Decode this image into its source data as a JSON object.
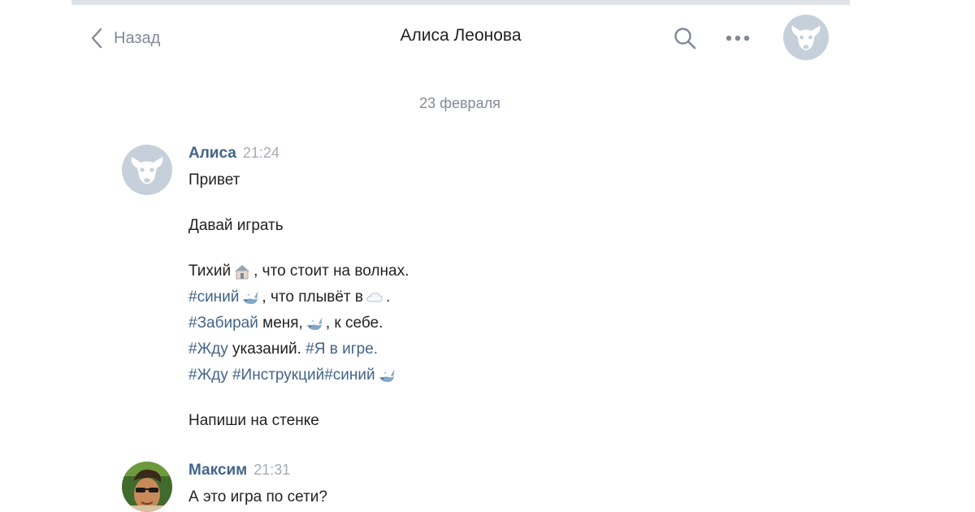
{
  "header": {
    "back_label": "Назад",
    "title": "Алиса Леонова"
  },
  "date_separator": "23 февраля",
  "colors": {
    "author": "#42648b",
    "muted": "#828a99",
    "timestamp": "#a4acb7",
    "avatar_placeholder": "#c5d0db"
  },
  "messages": [
    {
      "author": "Алиса",
      "time": "21:24",
      "lines": {
        "greeting": "Привет",
        "lets_play": "Давай играть",
        "poem_1a": "Тихий",
        "poem_1b": ", что стоит на волнах.",
        "poem_2a": "#синий",
        "poem_2b": ", что плывёт в",
        "poem_2c": ".",
        "poem_3a": "#Забирай",
        "poem_3b": "меня,",
        "poem_3c": ", к себе.",
        "poem_4a": "#Жду",
        "poem_4b": "указаний.",
        "poem_4c": "#Я в игре.",
        "poem_5a": "#Жду",
        "poem_5b": "#Инструкций",
        "poem_5c": "#синий",
        "write_on_wall": "Напиши на стенке"
      },
      "emoji": [
        "house-icon",
        "whale-icon",
        "cloud-icon",
        "whale-icon",
        "whale-icon"
      ]
    },
    {
      "author": "Максим",
      "time": "21:31",
      "text": "А это игра по сети?"
    }
  ]
}
